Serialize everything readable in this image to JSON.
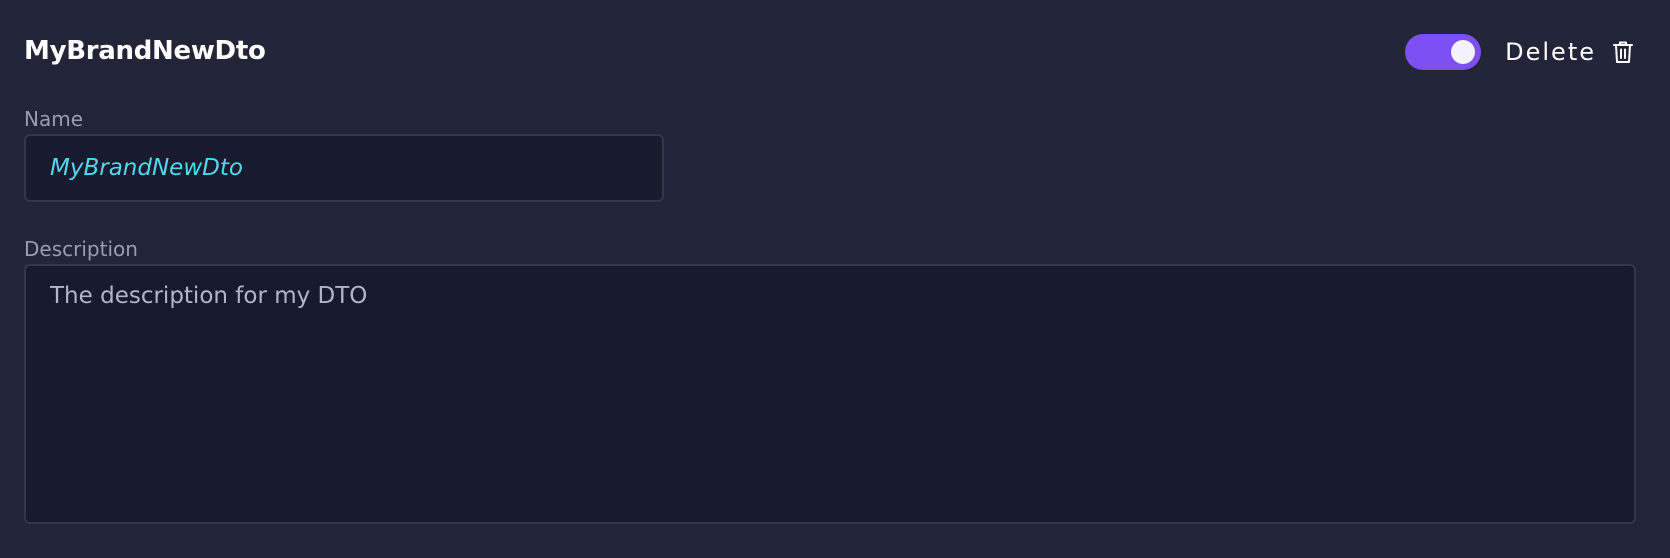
{
  "header": {
    "title": "MyBrandNewDto",
    "toggle": {
      "on": true,
      "accent_color": "#7c4ff0"
    },
    "delete_label": "Delete",
    "delete_icon": "trash-icon"
  },
  "form": {
    "name": {
      "label": "Name",
      "value": "MyBrandNewDto",
      "value_color": "#52d7ec"
    },
    "description": {
      "label": "Description",
      "value": "The description for my DTO"
    }
  },
  "colors": {
    "background": "#222438",
    "field_background": "#181a2d",
    "field_border": "#33364d",
    "label": "#9a9cb0"
  }
}
